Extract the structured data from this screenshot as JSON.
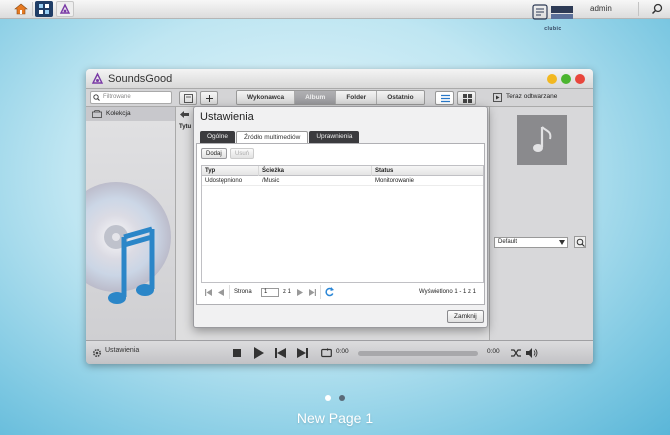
{
  "taskbar": {
    "user_label": "admin",
    "icons": [
      "home-icon",
      "app-center-icon",
      "soundsgood-icon",
      "search-icon"
    ]
  },
  "logo": {
    "text": "clubic"
  },
  "window": {
    "title": "SoundsGood",
    "controls": [
      "minimize",
      "maximize",
      "close"
    ],
    "control_colors": {
      "minimize": "#f2b820",
      "maximize": "#4cb52f",
      "close": "#e8463c"
    }
  },
  "toolbar": {
    "search_placeholder": "Filtrowane",
    "segments": [
      "Wykonawca",
      "Album",
      "Folder",
      "Ostatnio"
    ],
    "active_segment": "Album",
    "now_playing": "Teraz odtwarzane"
  },
  "sidebar": {
    "items": [
      {
        "label": "Kolekcja",
        "icon": "collection-icon"
      }
    ]
  },
  "center": {
    "column_label": "Tytu"
  },
  "right_panel": {
    "playlist_select": "Default"
  },
  "bottom_bar": {
    "settings_label": "Ustawienia",
    "time_elapsed": "0:00",
    "time_total": "0:00"
  },
  "modal": {
    "title": "Ustawienia",
    "tabs": [
      "Ogólne",
      "Źródło multimediów",
      "Uprawnienia"
    ],
    "active_tab": "Źródło multimediów",
    "add_label": "Dodaj",
    "remove_label": "Usuń",
    "table": {
      "columns": [
        "Typ",
        "Ścieżka",
        "Status"
      ],
      "rows": [
        [
          "Udostępniono",
          "/Music",
          "Monitorowanie"
        ]
      ]
    },
    "pager": {
      "page_label": "Strona",
      "page_value": "1",
      "of_label": "z 1",
      "summary": "Wyświetlono 1 - 1 z 1"
    },
    "close_label": "Zamknij"
  },
  "desktop": {
    "page_label": "New Page 1",
    "pages": 2,
    "active_page": 1
  }
}
